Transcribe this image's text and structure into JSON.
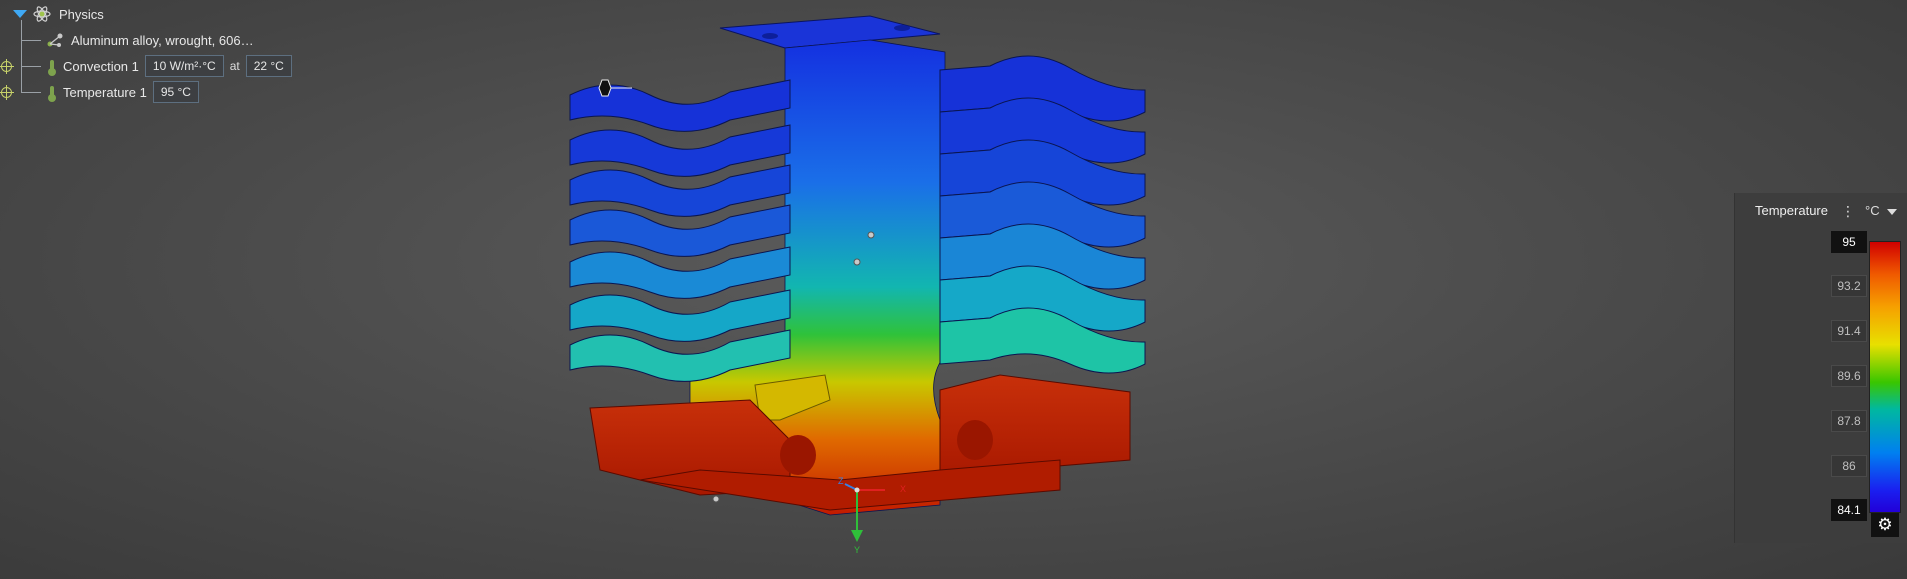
{
  "tree": {
    "root_label": "Physics",
    "material_label": "Aluminum alloy, wrought, 606…",
    "convection_label": "Convection 1",
    "convection_coeff": "10 W/m²·°C",
    "convection_at": "at",
    "convection_temp": "22 °C",
    "temperature_label": "Temperature 1",
    "temperature_value": "95 °C"
  },
  "legend": {
    "title": "Temperature",
    "unit": "°C",
    "ticks": [
      "95",
      "93.2",
      "91.4",
      "89.6",
      "87.8",
      "86",
      "84.1"
    ]
  },
  "axes": {
    "y_label": "Y",
    "z_label": "Z",
    "x_label": "X"
  },
  "colors": {
    "hot": "#c01c00",
    "cold": "#1a2ad8"
  }
}
